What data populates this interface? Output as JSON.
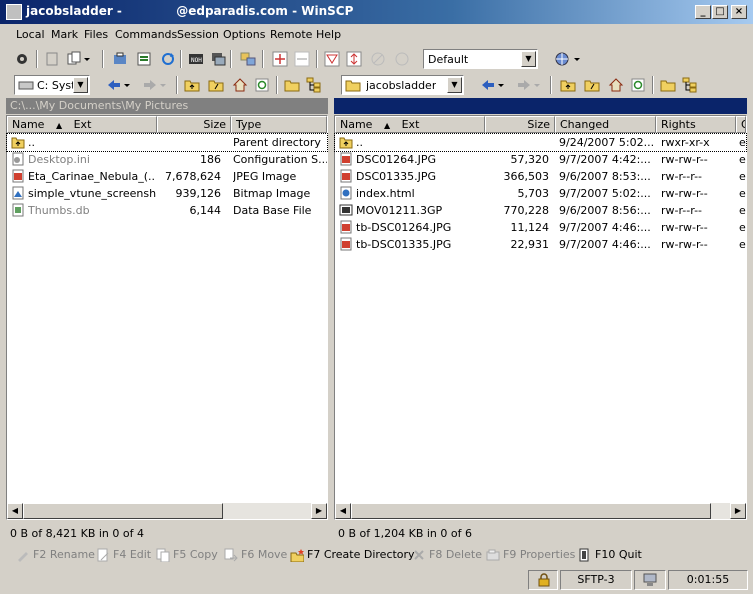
{
  "window": {
    "title": "jacobsladder -             @edparadis.com - WinSCP",
    "minimize": "_",
    "maximize": "□",
    "close": "×"
  },
  "menu": [
    "Local",
    "Mark",
    "Files",
    "Commands",
    "Session",
    "Options",
    "Remote",
    "Help"
  ],
  "toolbar": {
    "profile": "Default"
  },
  "left_panel": {
    "drive": "C: Syst",
    "path": "C:\\...\\My Documents\\My Pictures",
    "columns": [
      "Name",
      "Ext",
      "Size",
      "Type"
    ],
    "files": [
      {
        "name": "..",
        "size": "",
        "type": "Parent directory",
        "icon": "folder-up-icon",
        "color": "#000000"
      },
      {
        "name": "Desktop.ini",
        "size": "186",
        "type": "Configuration S...",
        "icon": "config-file-icon",
        "color": "#808080"
      },
      {
        "name": "Eta_Carinae_Nebula_(...",
        "size": "7,678,624",
        "type": "JPEG Image",
        "icon": "jpeg-file-icon",
        "color": "#000000"
      },
      {
        "name": "simple_vtune_screensh...",
        "size": "939,126",
        "type": "Bitmap Image",
        "icon": "bitmap-file-icon",
        "color": "#000000"
      },
      {
        "name": "Thumbs.db",
        "size": "6,144",
        "type": "Data Base File",
        "icon": "database-file-icon",
        "color": "#808080"
      }
    ],
    "status": "0 B of 8,421 KB in 0 of 4"
  },
  "right_panel": {
    "directory": "jacobsladder",
    "columns": [
      "Name",
      "Ext",
      "Size",
      "Changed",
      "Rights",
      "O"
    ],
    "files": [
      {
        "name": "..",
        "size": "",
        "changed": "9/24/2007 5:02...",
        "rights": "rwxr-xr-x",
        "owner": "e",
        "icon": "folder-up-icon"
      },
      {
        "name": "DSC01264.JPG",
        "size": "57,320",
        "changed": "9/7/2007 4:42:...",
        "rights": "rw-rw-r--",
        "owner": "e",
        "icon": "jpeg-file-icon"
      },
      {
        "name": "DSC01335.JPG",
        "size": "366,503",
        "changed": "9/6/2007 8:53:...",
        "rights": "rw-r--r--",
        "owner": "e",
        "icon": "jpeg-file-icon"
      },
      {
        "name": "index.html",
        "size": "5,703",
        "changed": "9/7/2007 5:02:...",
        "rights": "rw-rw-r--",
        "owner": "e",
        "icon": "html-file-icon"
      },
      {
        "name": "MOV01211.3GP",
        "size": "770,228",
        "changed": "9/6/2007 8:56:...",
        "rights": "rw-r--r--",
        "owner": "e",
        "icon": "video-file-icon"
      },
      {
        "name": "tb-DSC01264.JPG",
        "size": "11,124",
        "changed": "9/7/2007 4:46:...",
        "rights": "rw-rw-r--",
        "owner": "e",
        "icon": "jpeg-file-icon"
      },
      {
        "name": "tb-DSC01335.JPG",
        "size": "22,931",
        "changed": "9/7/2007 4:46:...",
        "rights": "rw-rw-r--",
        "owner": "e",
        "icon": "jpeg-file-icon"
      }
    ],
    "status": "0 B of 1,204 KB in 0 of 6"
  },
  "function_keys": [
    {
      "label": "F2 Rename",
      "enabled": false,
      "icon": "rename-icon"
    },
    {
      "label": "F4 Edit",
      "enabled": false,
      "icon": "edit-icon"
    },
    {
      "label": "F5 Copy",
      "enabled": false,
      "icon": "copy-icon"
    },
    {
      "label": "F6 Move",
      "enabled": false,
      "icon": "move-icon"
    },
    {
      "label": "F7 Create Directory",
      "enabled": true,
      "icon": "create-directory-icon"
    },
    {
      "label": "F8 Delete",
      "enabled": false,
      "icon": "delete-icon"
    },
    {
      "label": "F9 Properties",
      "enabled": false,
      "icon": "properties-icon"
    },
    {
      "label": "F10 Quit",
      "enabled": true,
      "icon": "quit-icon"
    }
  ],
  "statusbar": {
    "protocol": "SFTP-3",
    "elapsed": "0:01:55"
  },
  "colors": {
    "active_path": "#0a246a",
    "inactive_path": "#808080",
    "face": "#d4d0c8"
  }
}
